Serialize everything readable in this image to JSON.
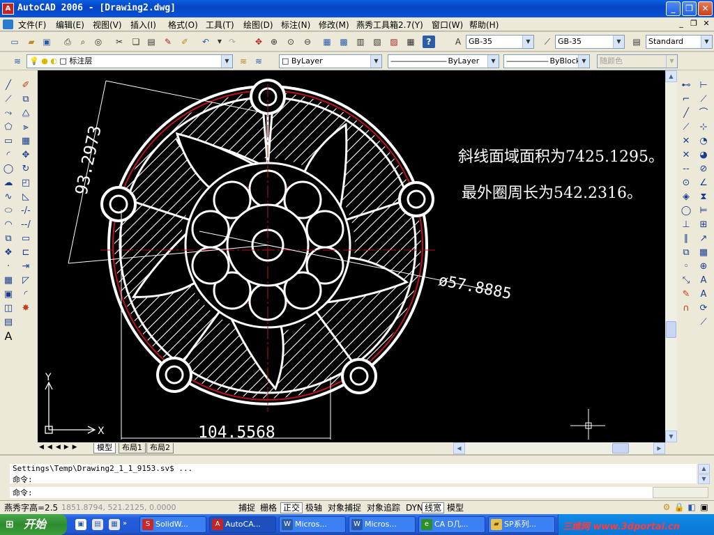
{
  "window": {
    "title": "AutoCAD 2006 - [Drawing2.dwg]",
    "app_icon": "autocad-icon",
    "minimize_glyph": "_",
    "maximize_glyph": "❐",
    "close_glyph": "✕"
  },
  "menu": {
    "items": [
      "文件(F)",
      "编辑(E)",
      "视图(V)",
      "插入(I)",
      "格式(O)",
      "工具(T)",
      "绘图(D)",
      "标注(N)",
      "修改(M)",
      "燕秀工具箱2.7(Y)",
      "窗口(W)",
      "帮助(H)"
    ]
  },
  "styles_toolbar": {
    "text_style": "GB-35",
    "dim_style": "GB-35",
    "table_style": "Standard"
  },
  "layers_toolbar": {
    "current_layer": "标注层",
    "color": "ByLayer",
    "linetype": "ByLayer",
    "lineweight": "ByBlock",
    "plot_style": "随颜色"
  },
  "drawing": {
    "dimension_vertical": "93.2973",
    "dimension_horizontal": "104.5568",
    "dimension_diameter": "ø57.8885",
    "note_area": "斜线面域面积为7425.1295。",
    "note_perimeter": "最外圈周长为542.2316。",
    "ucs_x": "X",
    "ucs_y": "Y"
  },
  "layout_tabs": [
    "模型",
    "布局1",
    "布局2"
  ],
  "command": {
    "history_line": "Settings\\Temp\\Drawing2_1_1_9153.sv$ ...",
    "prompt_line_1": "命令:",
    "prompt_line_2": "命令:"
  },
  "status": {
    "text_height": "燕秀字高=2.5",
    "coordinates": "1851.8794, 521.2125, 0.0000",
    "toggles": [
      "捕捉",
      "栅格",
      "正交",
      "极轴",
      "对象捕捉",
      "对象追踪",
      "DYN",
      "线宽",
      "模型"
    ],
    "toggles_on": [
      "正交",
      "线宽"
    ]
  },
  "taskbar": {
    "start_label": "开始",
    "tasks": [
      {
        "label": "SolidW...",
        "icon": "solidworks-icon",
        "color": "#c8282a"
      },
      {
        "label": "AutoCA...",
        "icon": "autocad-icon",
        "color": "#c62424"
      },
      {
        "label": "Micros...",
        "icon": "document-icon",
        "color": "#2a5caa"
      },
      {
        "label": "Micros...",
        "icon": "document-icon",
        "color": "#2a5caa"
      },
      {
        "label": "CA D几...",
        "icon": "browser-icon",
        "color": "#2b8f2b"
      },
      {
        "label": "SP系列...",
        "icon": "folder-icon",
        "color": "#e8c04a"
      }
    ],
    "watermark": "三维网 www.3dportal.cn"
  }
}
